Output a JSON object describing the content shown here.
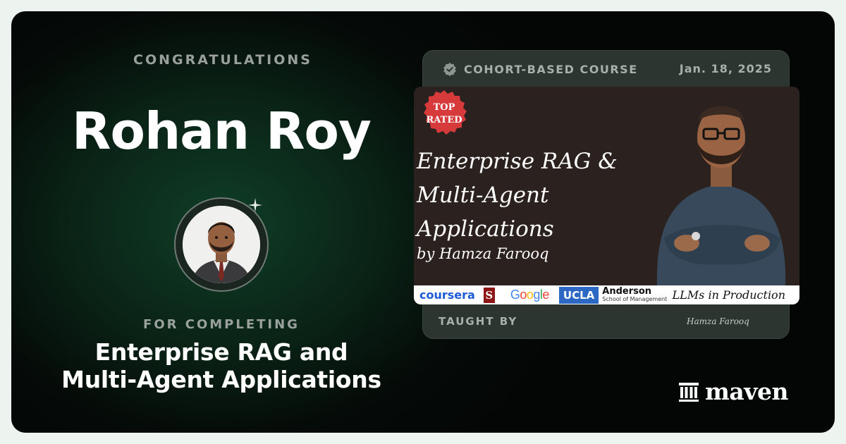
{
  "certificate": {
    "congratulations_label": "CONGRATULATIONS",
    "recipient_name": "Rohan Roy",
    "for_completing_label": "FOR COMPLETING",
    "course_title_line1": "Enterprise RAG and",
    "course_title_line2": "Multi-Agent Applications"
  },
  "course_card": {
    "type_label": "COHORT-BASED COURSE",
    "date": "Jan. 18, 2025",
    "taught_by_label": "TAUGHT BY",
    "signature_text": "Hamza Farooq",
    "banner": {
      "seal_line1": "TOP",
      "seal_line2": "RATED",
      "title_line1": "Enterprise RAG &",
      "title_line2": "Multi-Agent",
      "title_line3": "Applications",
      "byline": "by Hamza Farooq",
      "logos": {
        "coursera": "coursera",
        "stanford": "S",
        "google": [
          "G",
          "o",
          "o",
          "g",
          "l",
          "e"
        ],
        "ucla": "UCLA",
        "anderson_line1": "Anderson",
        "anderson_line2": "School of Management",
        "tagline": "LLMs in Production"
      }
    }
  },
  "brand": {
    "name": "maven"
  },
  "colors": {
    "background_dark": "#050b08",
    "green_glow": "#103e27",
    "muted_text": "#9aa19d",
    "card_bg": "#2c3530",
    "seal_red": "#d63a3a"
  },
  "icons": {
    "verified": "verified-badge-icon",
    "sparkle": "sparkle-icon",
    "brand": "maven-columns-icon"
  }
}
